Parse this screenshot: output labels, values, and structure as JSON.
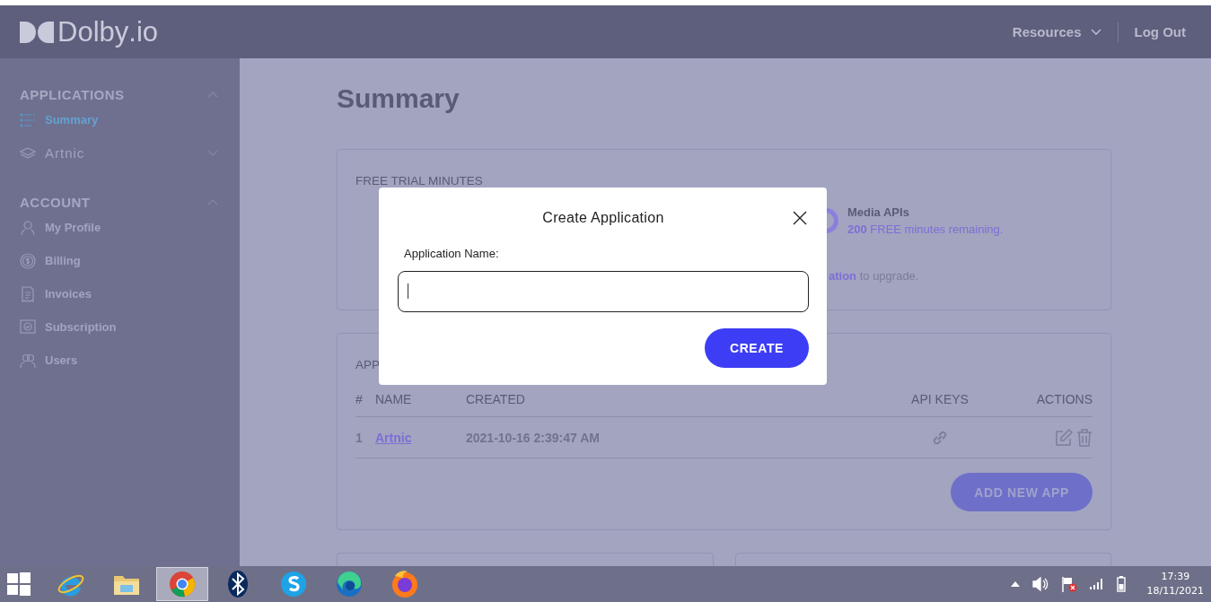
{
  "header": {
    "logo": "Dolby",
    "logo_suffix": ".io",
    "nav": [
      {
        "label": "Resources",
        "dropdown": true
      },
      {
        "label": "Log Out",
        "dropdown": false
      }
    ]
  },
  "sidebar": {
    "groups": [
      {
        "title": "APPLICATIONS",
        "expanded": true,
        "items": [
          {
            "label": "Summary",
            "selected": true
          },
          {
            "label": "Artnic",
            "selected": false,
            "expanded": false
          }
        ]
      },
      {
        "title": "ACCOUNT",
        "expanded": true,
        "items": [
          {
            "label": "My Profile",
            "selected": false
          },
          {
            "label": "Billing",
            "selected": false
          },
          {
            "label": "Invoices",
            "selected": false
          },
          {
            "label": "Subscription",
            "selected": false
          },
          {
            "label": "Users",
            "selected": false
          }
        ]
      }
    ]
  },
  "page_title": "Summary",
  "trial_card": {
    "heading": "FREE TRIAL MINUTES",
    "product": "Media APIs",
    "remaining": "**200** FREE minutes remaining.",
    "upgrade": "**ation** to upgrade."
  },
  "apps_card": {
    "heading": "APP",
    "columns": [
      "#",
      "NAME",
      "CREATED",
      "API KEYS",
      "ACTIONS"
    ],
    "rows": [
      {
        "index": "1",
        "name": "Artnic",
        "created": "2021-10-16 2:39:47 AM"
      }
    ],
    "add_button": "ADD NEW APP"
  },
  "modal": {
    "title": "Create Application",
    "field_label": "Application Name:",
    "button": "CREATE"
  },
  "taskbar": {
    "apps": [
      {
        "selected": false
      },
      {
        "selected": false
      },
      {
        "selected": true
      },
      {
        "selected": false
      },
      {
        "selected": false
      },
      {
        "selected": false
      },
      {
        "selected": false
      }
    ],
    "time": "17:39",
    "date": "18/11/2021"
  }
}
